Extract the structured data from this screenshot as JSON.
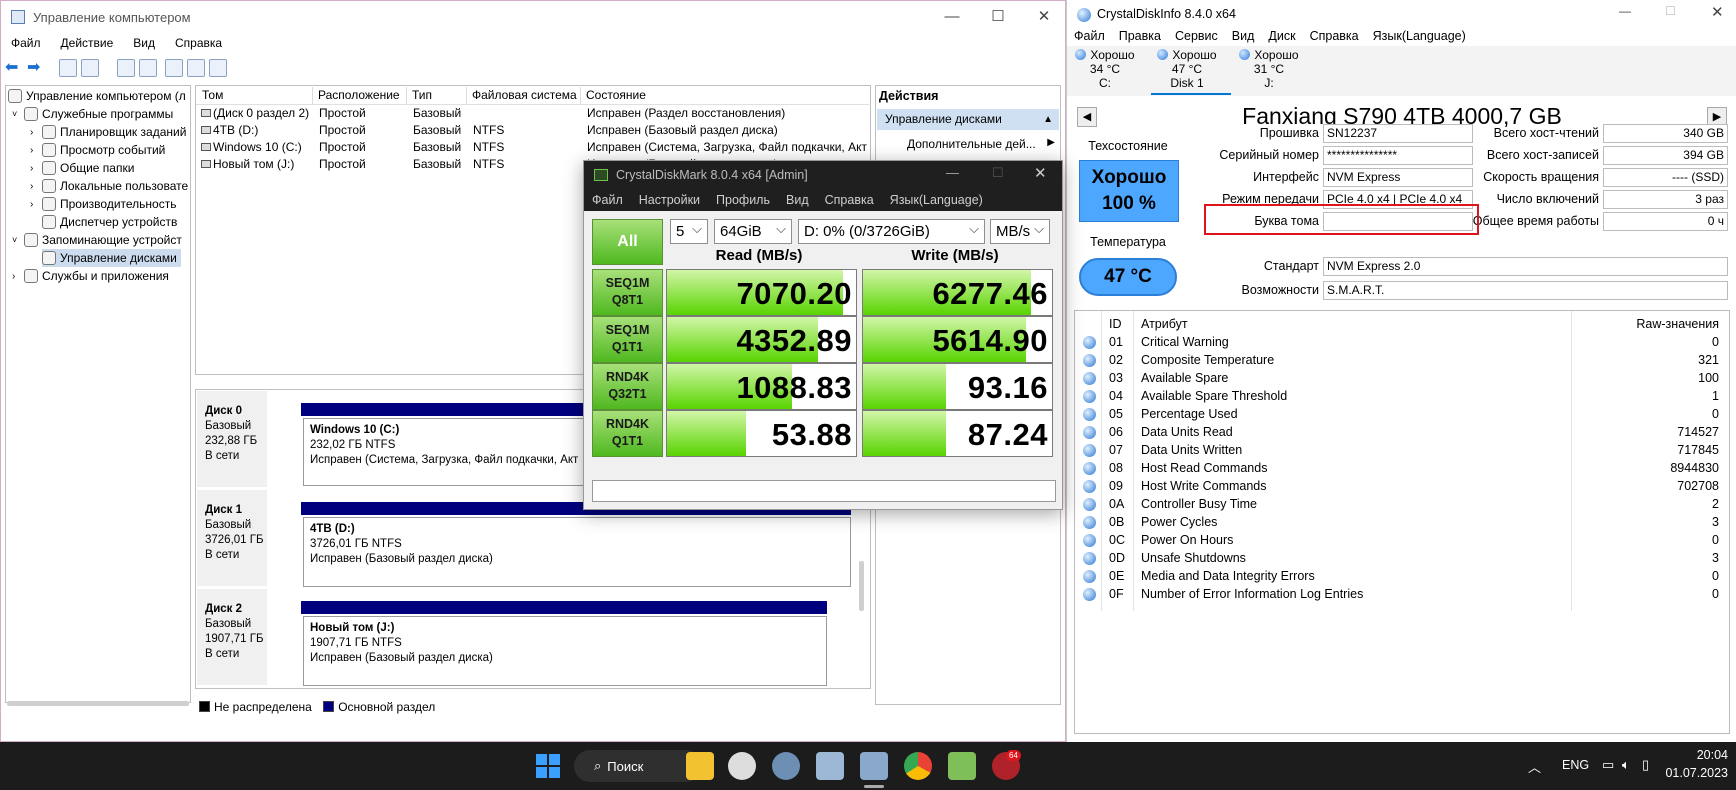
{
  "cm": {
    "title": "Управление компьютером",
    "menu": [
      "Файл",
      "Действие",
      "Вид",
      "Справка"
    ],
    "tree": [
      {
        "label": "Управление компьютером (л",
        "level": 0
      },
      {
        "label": "Служебные программы",
        "level": 1
      },
      {
        "label": "Планировщик заданий",
        "level": 2
      },
      {
        "label": "Просмотр событий",
        "level": 2
      },
      {
        "label": "Общие папки",
        "level": 2
      },
      {
        "label": "Локальные пользовате",
        "level": 2
      },
      {
        "label": "Производительность",
        "level": 2
      },
      {
        "label": "Диспетчер устройств",
        "level": 2
      },
      {
        "label": "Запоминающие устройст",
        "level": 1
      },
      {
        "label": "Управление дисками",
        "level": 2
      },
      {
        "label": "Службы и приложения",
        "level": 1
      }
    ],
    "columns": [
      "Том",
      "Расположение",
      "Тип",
      "Файловая система",
      "Состояние"
    ],
    "volumes": [
      [
        "(Диск 0 раздел 2)",
        "Простой",
        "Базовый",
        "",
        "Исправен (Раздел восстановления)"
      ],
      [
        "4TB (D:)",
        "Простой",
        "Базовый",
        "NTFS",
        "Исправен (Базовый раздел диска)"
      ],
      [
        "Windows 10 (C:)",
        "Простой",
        "Базовый",
        "NTFS",
        "Исправен (Система, Загрузка, Файл подкачки, Акти"
      ],
      [
        "Новый том (J:)",
        "Простой",
        "Базовый",
        "NTFS",
        "Исправен (Базовый раздел диска)"
      ]
    ],
    "disks": [
      {
        "name": "Диск 0",
        "type": "Базовый",
        "size": "232,88 ГБ",
        "status": "В сети",
        "part_name": "Windows 10  (C:)",
        "part_size": "232,02 ГБ NTFS",
        "part_status": "Исправен (Система, Загрузка, Файл подкачки, Акт"
      },
      {
        "name": "Диск 1",
        "type": "Базовый",
        "size": "3726,01 ГБ",
        "status": "В сети",
        "part_name": "4TB  (D:)",
        "part_size": "3726,01 ГБ NTFS",
        "part_status": "Исправен (Базовый раздел диска)"
      },
      {
        "name": "Диск 2",
        "type": "Базовый",
        "size": "1907,71 ГБ",
        "status": "В сети",
        "part_name": "Новый том  (J:)",
        "part_size": "1907,71 ГБ NTFS",
        "part_status": "Исправен (Базовый раздел диска)"
      }
    ],
    "legend": {
      "unallocated": "Не распределена",
      "primary": "Основной раздел"
    },
    "actions": {
      "title": "Действия",
      "section": "Управление дисками",
      "more": "Дополнительные дей..."
    }
  },
  "cdm": {
    "title": "CrystalDiskMark 8.0.4 x64 [Admin]",
    "menu": [
      "Файл",
      "Настройки",
      "Профиль",
      "Вид",
      "Справка",
      "Язык(Language)"
    ],
    "all_button": "All",
    "count": "5",
    "size": "64GiB",
    "drive": "D: 0% (0/3726GiB)",
    "unit": "MB/s",
    "read_header": "Read (MB/s)",
    "write_header": "Write (MB/s)",
    "rows": [
      {
        "l1": "SEQ1M",
        "l2": "Q8T1",
        "read": "7070.20",
        "write": "6277.46",
        "read_fill": 0.93,
        "write_fill": 0.89
      },
      {
        "l1": "SEQ1M",
        "l2": "Q1T1",
        "read": "4352.89",
        "write": "5614.90",
        "read_fill": 0.8,
        "write_fill": 0.86
      },
      {
        "l1": "RND4K",
        "l2": "Q32T1",
        "read": "1088.83",
        "write": "93.16",
        "read_fill": 0.66,
        "write_fill": 0.44
      },
      {
        "l1": "RND4K",
        "l2": "Q1T1",
        "read": "53.88",
        "write": "87.24",
        "read_fill": 0.42,
        "write_fill": 0.44
      }
    ]
  },
  "cdi": {
    "title": "CrystalDiskInfo 8.4.0 x64",
    "menu": [
      "Файл",
      "Правка",
      "Сервис",
      "Вид",
      "Диск",
      "Справка",
      "Язык(Language)"
    ],
    "disks": [
      {
        "status": "Хорошо",
        "temp": "34 °C",
        "label": "C:"
      },
      {
        "status": "Хорошо",
        "temp": "47 °C",
        "label": "Disk 1"
      },
      {
        "status": "Хорошо",
        "temp": "31 °C",
        "label": "J:"
      }
    ],
    "model": "Fanxiang S790 4TB 4000,7 GB",
    "health_label": "Техсостояние",
    "health_status": "Хорошо",
    "health_pct": "100 %",
    "temp_label": "Температура",
    "temp": "47 °C",
    "fields_left": [
      {
        "label": "Прошивка",
        "value": "SN12237"
      },
      {
        "label": "Серийный номер",
        "value": "***************"
      },
      {
        "label": "Интерфейс",
        "value": "NVM Express"
      },
      {
        "label": "Режим передачи",
        "value": "PCIe 4.0 x4 | PCIe 4.0 x4"
      },
      {
        "label": "Буква тома",
        "value": ""
      }
    ],
    "standard_label": "Стандарт",
    "standard": "NVM Express 2.0",
    "features_label": "Возможности",
    "features": "S.M.A.R.T.",
    "fields_right": [
      {
        "label": "Всего хост-чтений",
        "value": "340 GB"
      },
      {
        "label": "Всего хост-записей",
        "value": "394 GB"
      },
      {
        "label": "Скорость вращения",
        "value": "---- (SSD)"
      },
      {
        "label": "Число включений",
        "value": "3 раз"
      },
      {
        "label": "Общее время работы",
        "value": "0 ч"
      }
    ],
    "smart_headers": {
      "id": "ID",
      "attr": "Атрибут",
      "raw": "Raw-значения"
    },
    "smart": [
      {
        "id": "01",
        "name": "Critical Warning",
        "raw": "0"
      },
      {
        "id": "02",
        "name": "Composite Temperature",
        "raw": "321"
      },
      {
        "id": "03",
        "name": "Available Spare",
        "raw": "100"
      },
      {
        "id": "04",
        "name": "Available Spare Threshold",
        "raw": "1"
      },
      {
        "id": "05",
        "name": "Percentage Used",
        "raw": "0"
      },
      {
        "id": "06",
        "name": "Data Units Read",
        "raw": "714527"
      },
      {
        "id": "07",
        "name": "Data Units Written",
        "raw": "717845"
      },
      {
        "id": "08",
        "name": "Host Read Commands",
        "raw": "8944830"
      },
      {
        "id": "09",
        "name": "Host Write Commands",
        "raw": "702708"
      },
      {
        "id": "0A",
        "name": "Controller Busy Time",
        "raw": "2"
      },
      {
        "id": "0B",
        "name": "Power Cycles",
        "raw": "3"
      },
      {
        "id": "0C",
        "name": "Power On Hours",
        "raw": "0"
      },
      {
        "id": "0D",
        "name": "Unsafe Shutdowns",
        "raw": "3"
      },
      {
        "id": "0E",
        "name": "Media and Data Integrity Errors",
        "raw": "0"
      },
      {
        "id": "0F",
        "name": "Number of Error Information Log Entries",
        "raw": "0"
      }
    ]
  },
  "taskbar": {
    "search": "Поиск",
    "lang": "ENG",
    "time": "20:04",
    "date": "01.07.2023",
    "badge": "64"
  },
  "colors": {
    "highlight": "#e0151c",
    "accent": "#0078d4",
    "partition": "#00007f",
    "health_bg": "#4ea7ff"
  }
}
